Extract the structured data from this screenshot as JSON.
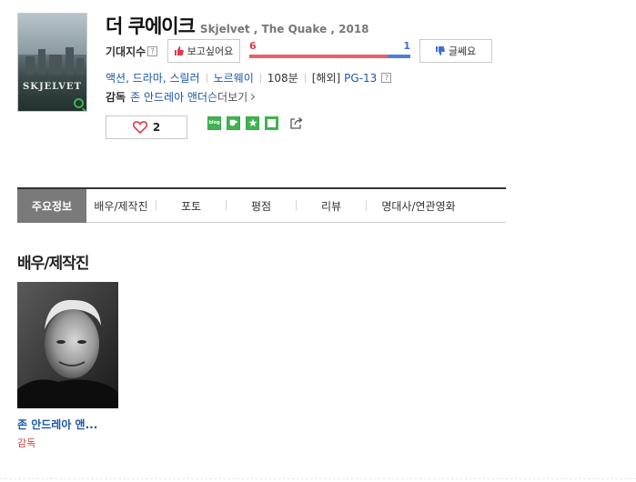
{
  "movie": {
    "title": "더 쿠에이크",
    "original": "Skjelvet , The Quake , 2018",
    "poster_title": "SKJELVET",
    "poster_icon": "magnifier-icon"
  },
  "expect": {
    "label": "기대지수",
    "help": "?",
    "like_label": "보고싶어요",
    "dislike_label": "글쎄요",
    "like_count": "6",
    "dislike_count": "1",
    "like_ratio": 0.857
  },
  "info": {
    "genres": "액션, 드라마, 스릴러",
    "country": "노르웨이",
    "runtime": "108분",
    "rating_prefix": "[해외]",
    "rating": "PG-13",
    "help": "?"
  },
  "director": {
    "label": "감독",
    "name": "존 안드레아 앤더슨",
    "more": "더보기"
  },
  "favorite": {
    "count": "2"
  },
  "share": {
    "icons": [
      "blog-icon",
      "cafe-icon",
      "star-icon",
      "memo-icon",
      "share-icon"
    ],
    "blog_text": "blog"
  },
  "tabs": [
    "주요정보",
    "배우/제작진",
    "포토",
    "평점",
    "리뷰",
    "명대사/연관영화"
  ],
  "cast_section": {
    "title": "배우/제작진",
    "people": [
      {
        "name": "존 안드레아 앤...",
        "role": "감독"
      }
    ]
  },
  "colors": {
    "link": "#1b57a8",
    "like": "#e0394d",
    "dislike": "#3b6fd8",
    "share_green": "#3fb34f",
    "active_tab": "#7a7a7a"
  }
}
